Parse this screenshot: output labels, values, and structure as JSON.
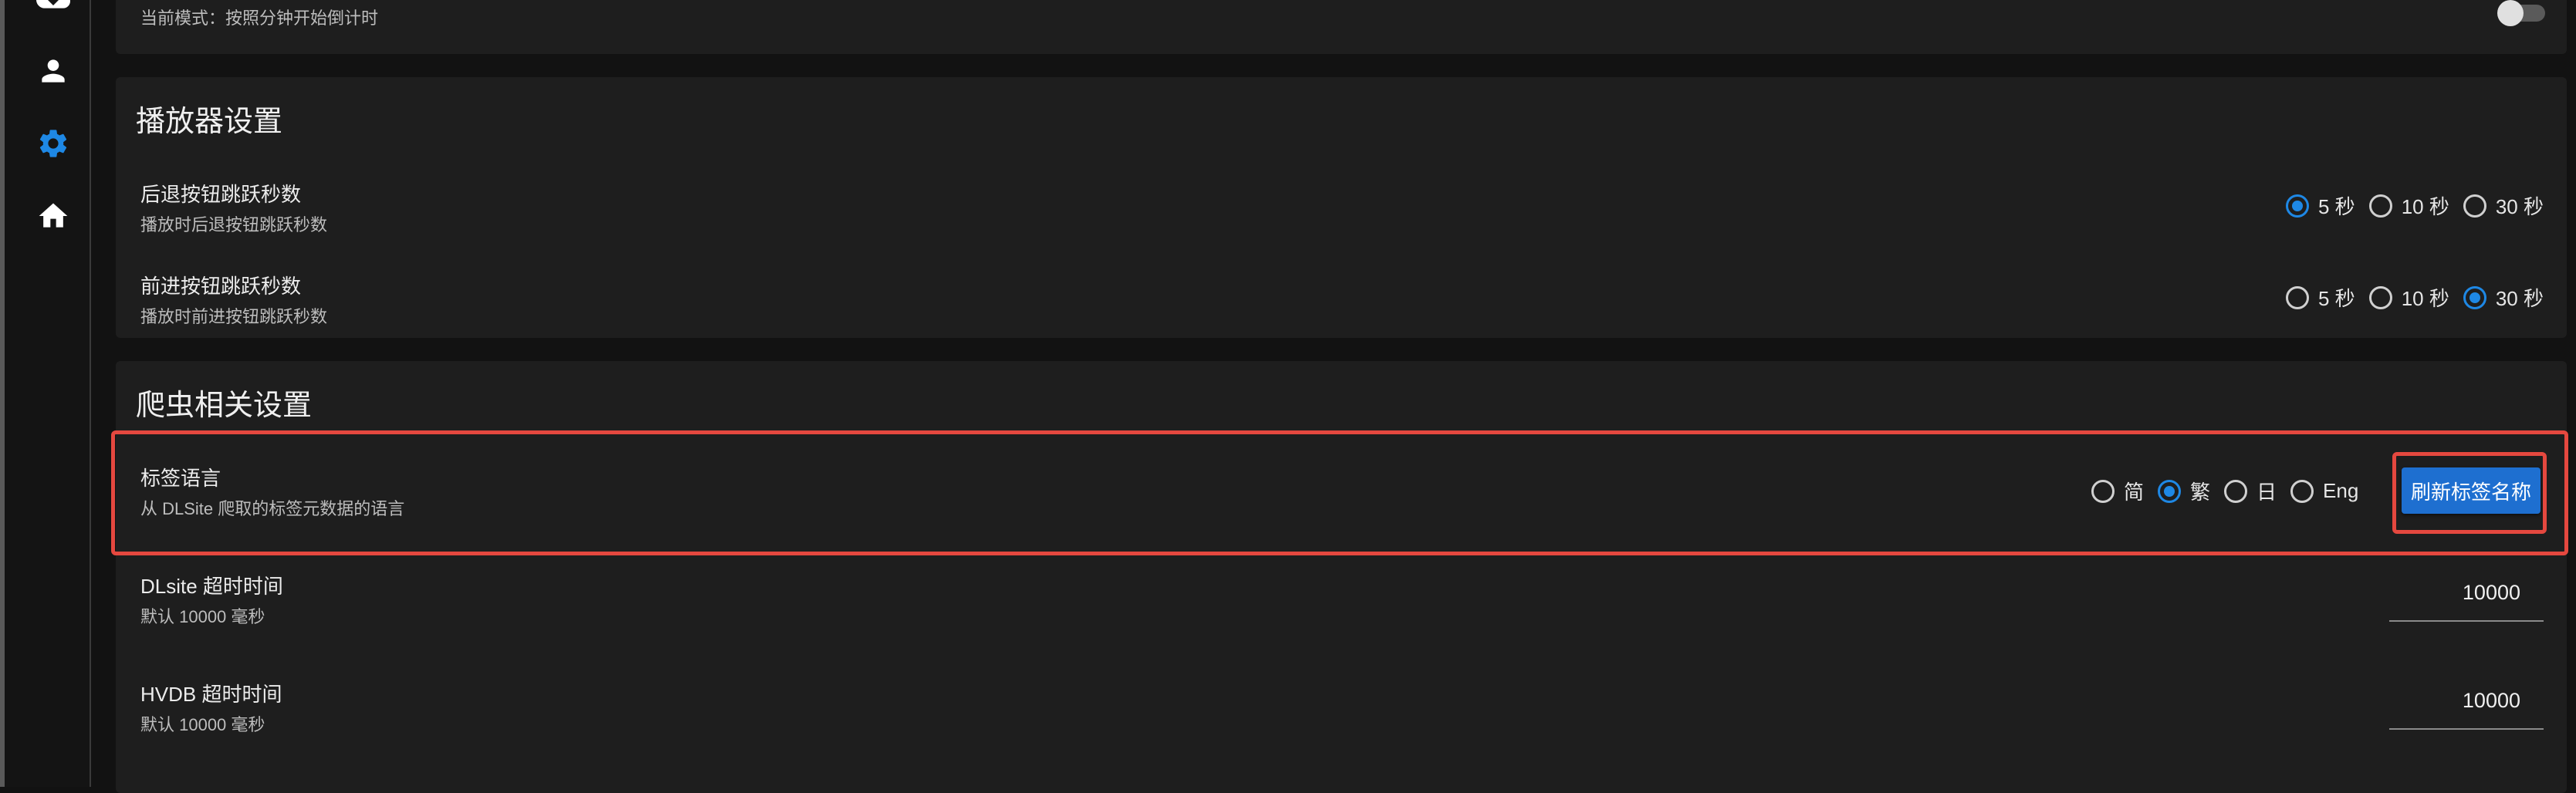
{
  "top_card": {
    "mode_text": "当前模式：按照分钟开始倒计时"
  },
  "player_settings": {
    "title": "播放器设置",
    "rewind": {
      "title": "后退按钮跳跃秒数",
      "subtitle": "播放时后退按钮跳跃秒数",
      "options": [
        "5 秒",
        "10 秒",
        "30 秒"
      ],
      "selected": "5 秒"
    },
    "forward": {
      "title": "前进按钮跳跃秒数",
      "subtitle": "播放时前进按钮跳跃秒数",
      "options": [
        "5 秒",
        "10 秒",
        "30 秒"
      ],
      "selected": "30 秒"
    }
  },
  "crawler_settings": {
    "title": "爬虫相关设置",
    "tag_language": {
      "title": "标签语言",
      "subtitle": "从 DLSite 爬取的标签元数据的语言",
      "options": [
        "简",
        "繁",
        "日",
        "Eng"
      ],
      "selected": "繁",
      "refresh_button": "刷新标签名称"
    },
    "dlsite_timeout": {
      "title": "DLsite 超时时间",
      "subtitle": "默认 10000 毫秒",
      "value": "10000"
    },
    "hvdb_timeout": {
      "title": "HVDB 超时时间",
      "subtitle": "默认 10000 毫秒",
      "value": "10000"
    }
  },
  "sidebar": {
    "icons": [
      "download-icon",
      "person-icon",
      "settings-gear-icon",
      "home-icon"
    ],
    "active": "settings-gear-icon"
  },
  "colors": {
    "accent": "#1e88e5",
    "highlight": "#e5483f",
    "card": "#1e1e1e",
    "background": "#121212"
  }
}
